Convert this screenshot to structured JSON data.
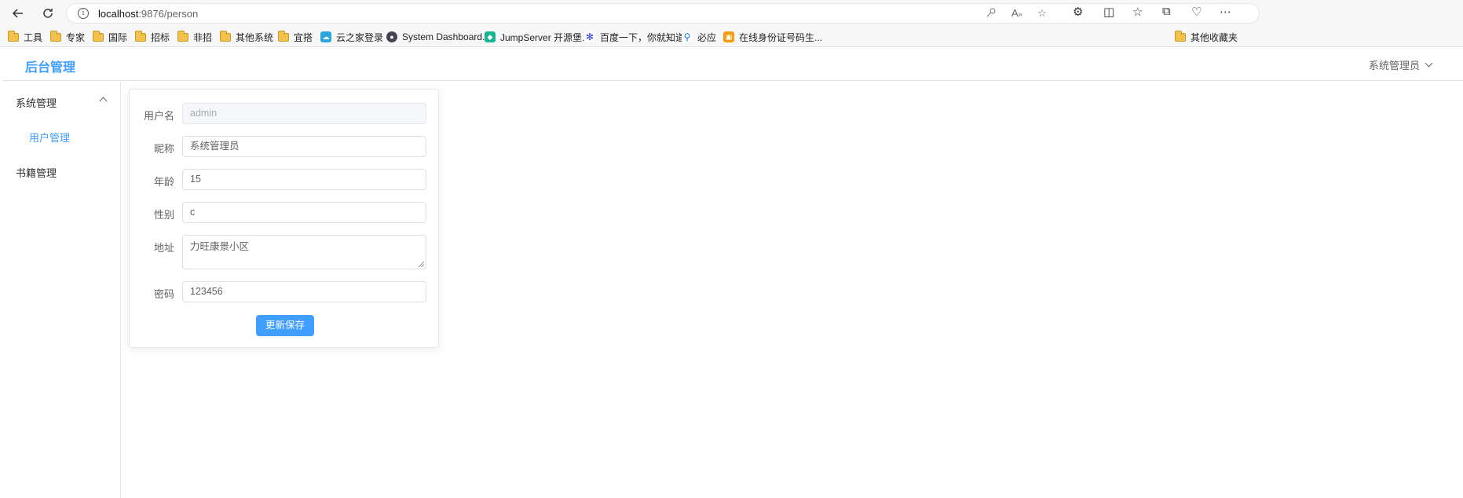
{
  "browser": {
    "url_host": "localhost",
    "url_rest": ":9876/person",
    "bookmarks": [
      {
        "label": "工具",
        "icon": "folder-icon"
      },
      {
        "label": "专家",
        "icon": "folder-icon"
      },
      {
        "label": "国际",
        "icon": "folder-icon"
      },
      {
        "label": "招标",
        "icon": "folder-icon"
      },
      {
        "label": "非招",
        "icon": "folder-icon"
      },
      {
        "label": "其他系统",
        "icon": "folder-icon"
      },
      {
        "label": "宜搭",
        "icon": "folder-icon"
      },
      {
        "label": "云之家登录",
        "icon": "cloud-icon"
      },
      {
        "label": "System Dashboard...",
        "icon": "dashboard-icon"
      },
      {
        "label": "JumpServer 开源堡...",
        "icon": "jumpserver-icon"
      },
      {
        "label": "百度一下，你就知道",
        "icon": "baidu-icon"
      },
      {
        "label": "必应",
        "icon": "search-icon"
      },
      {
        "label": "在线身份证号码生...",
        "icon": "id-card-icon"
      }
    ],
    "other_bookmarks": "其他收藏夹"
  },
  "header": {
    "brand": "后台管理",
    "user": "系统管理员"
  },
  "sidebar": {
    "menus": [
      {
        "label": "系统管理",
        "expanded": true,
        "children": [
          {
            "label": "用户管理",
            "active": true
          }
        ]
      },
      {
        "label": "书籍管理"
      }
    ]
  },
  "form": {
    "username": {
      "label": "用户名",
      "value": "admin",
      "disabled": true
    },
    "nickname": {
      "label": "昵称",
      "value": "系统管理员"
    },
    "age": {
      "label": "年龄",
      "value": "15"
    },
    "sex": {
      "label": "性别",
      "value": "c"
    },
    "address": {
      "label": "地址",
      "value": "力旺康景小区"
    },
    "password": {
      "label": "密码",
      "value": "123456"
    },
    "submit": "更新保存"
  },
  "colors": {
    "accent": "#409eff",
    "border": "#dcdfe6",
    "disabled_bg": "#f5f7fa"
  }
}
